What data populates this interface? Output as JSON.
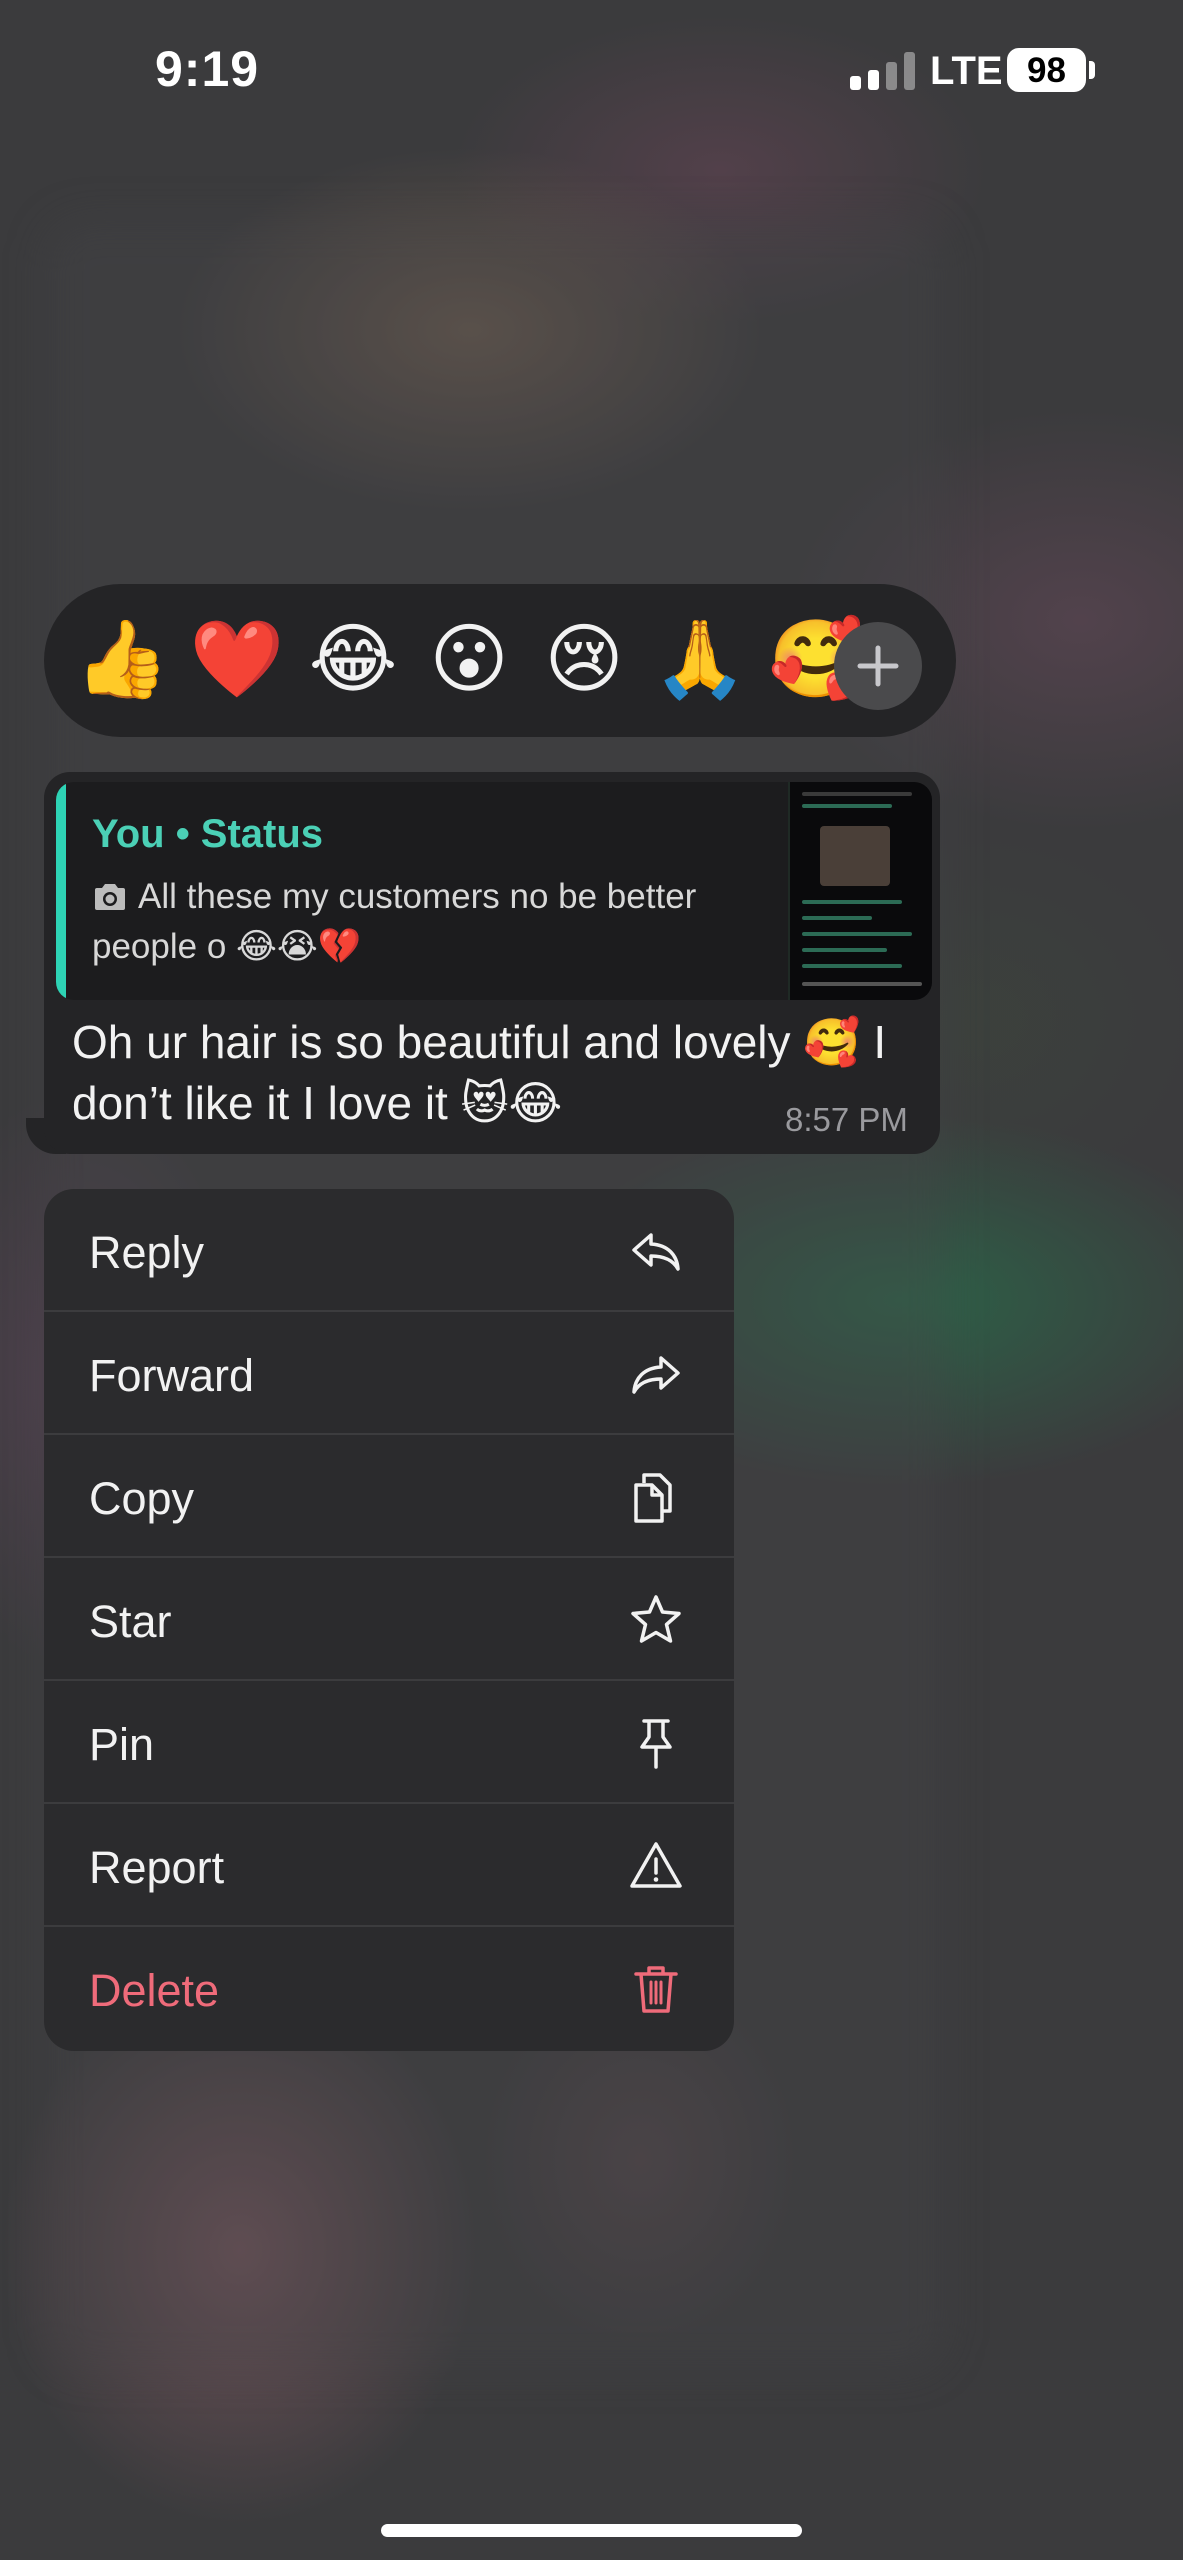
{
  "status_bar": {
    "time": "9:19",
    "network": "LTE",
    "battery_level": "98"
  },
  "reactions": {
    "emojis": [
      "👍",
      "❤️",
      "😂",
      "😮",
      "😢",
      "🙏",
      "🥰"
    ],
    "add_icon": "plus-icon"
  },
  "message": {
    "quote": {
      "author": "You • Status",
      "text": "All these my customers no be better people o 😂😭💔",
      "media_icon": "camera-icon"
    },
    "text": "Oh ur hair is so beautiful and lovely 🥰 I don’t like it I love it 😻😂",
    "time": "8:57 PM"
  },
  "menu": {
    "items": [
      {
        "label": "Reply",
        "icon": "reply-icon"
      },
      {
        "label": "Forward",
        "icon": "forward-icon"
      },
      {
        "label": "Copy",
        "icon": "copy-icon"
      },
      {
        "label": "Star",
        "icon": "star-icon"
      },
      {
        "label": "Pin",
        "icon": "pin-icon"
      },
      {
        "label": "Report",
        "icon": "warning-icon"
      },
      {
        "label": "Delete",
        "icon": "trash-icon"
      }
    ]
  },
  "colors": {
    "accent": "#4bd0b6",
    "danger": "#ef6b7a",
    "surface": "#242426",
    "menu_surface": "#2b2b2d"
  }
}
